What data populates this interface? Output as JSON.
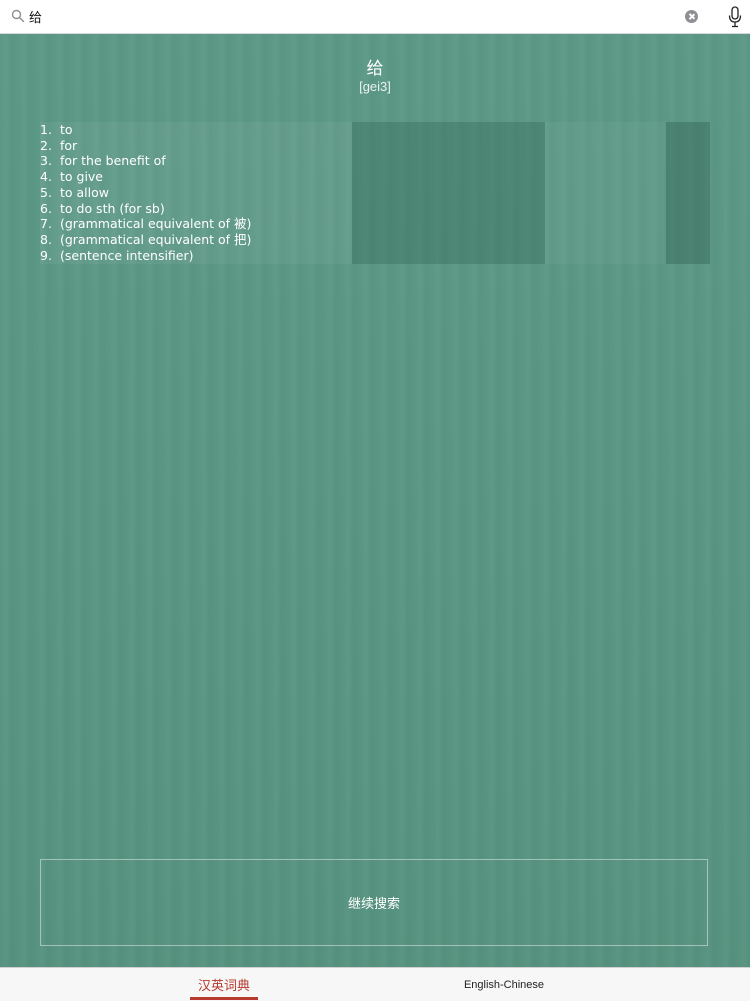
{
  "search": {
    "value": "给",
    "placeholder": ""
  },
  "entry": {
    "headword": "给",
    "pinyin": "[gei3]",
    "definitions": [
      {
        "num": "1.",
        "text": "to"
      },
      {
        "num": "2.",
        "text": "for"
      },
      {
        "num": "3.",
        "text": "for the benefit of"
      },
      {
        "num": "4.",
        "text": "to give"
      },
      {
        "num": "5.",
        "text": "to allow"
      },
      {
        "num": "6.",
        "text": "to do sth (for sb)"
      },
      {
        "num": "7.",
        "text": "(grammatical equivalent of 被)"
      },
      {
        "num": "8.",
        "text": "(grammatical equivalent of 把)"
      },
      {
        "num": "9.",
        "text": "(sentence intensifier)"
      }
    ]
  },
  "actions": {
    "continue_search_label": "继续搜索"
  },
  "tabs": [
    {
      "label": "汉英词典",
      "active": true
    },
    {
      "label": "English-Chinese",
      "active": false
    }
  ],
  "colors": {
    "background": "#5a9684",
    "accent": "#b83a2e",
    "text_on_background": "#ffffff"
  },
  "icons": [
    "search-icon",
    "clear-icon",
    "microphone-icon"
  ]
}
